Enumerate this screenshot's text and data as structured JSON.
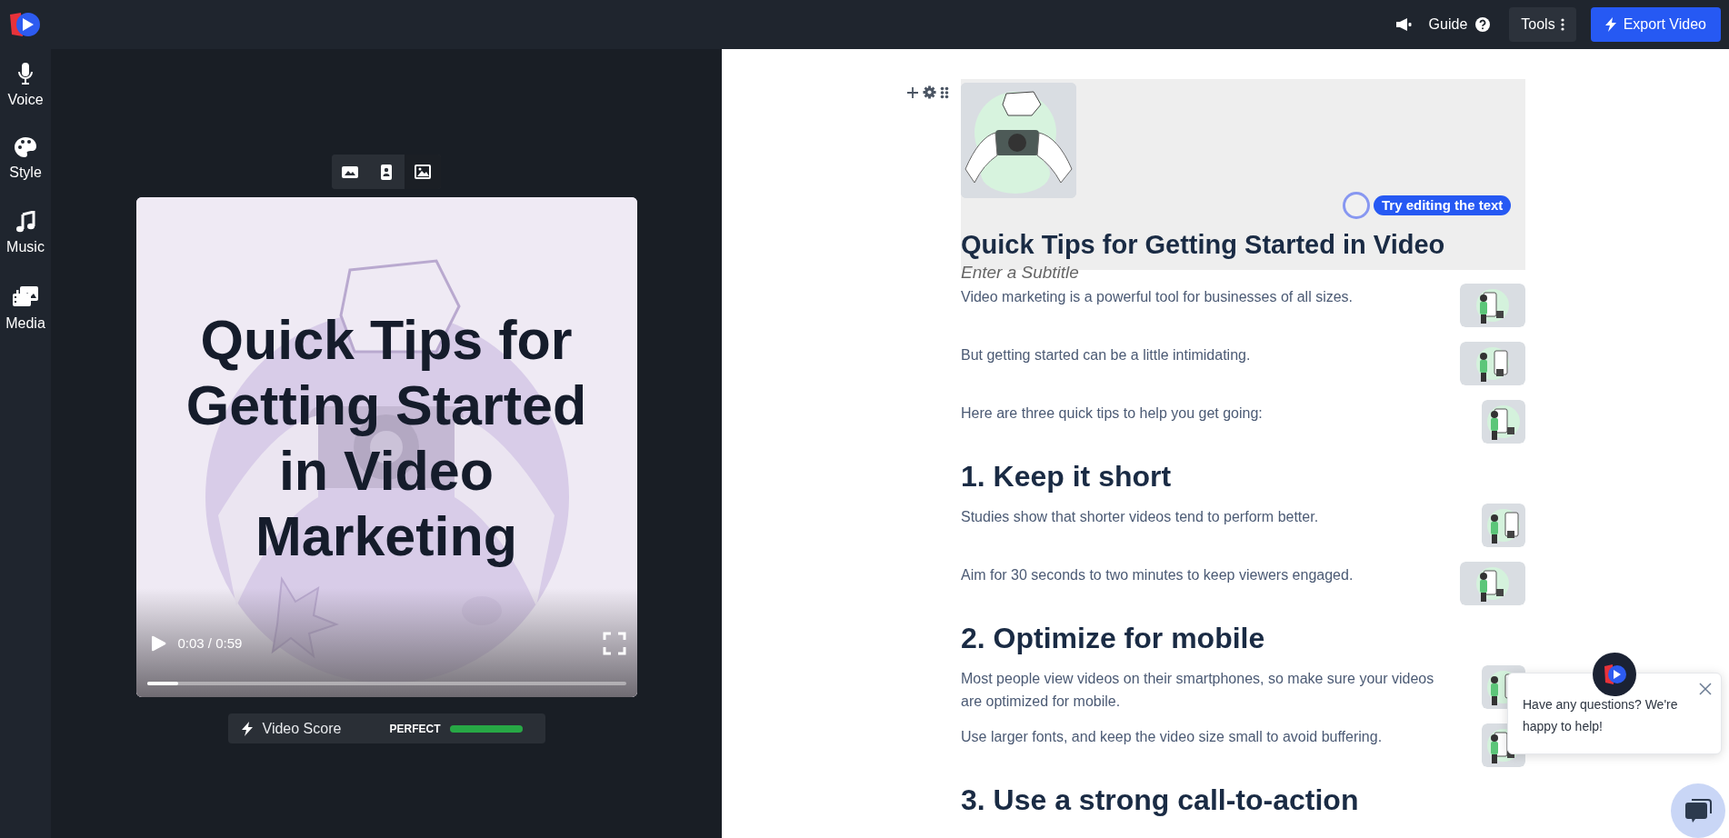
{
  "top_bar": {
    "guide_label": "Guide",
    "tools_label": "Tools",
    "export_label": "Export Video"
  },
  "sidebar": {
    "items": [
      {
        "label": "Voice"
      },
      {
        "label": "Style"
      },
      {
        "label": "Music"
      },
      {
        "label": "Media"
      }
    ]
  },
  "video_preview": {
    "layout_buttons": [
      {
        "selected": false
      },
      {
        "selected": false
      },
      {
        "selected": true
      }
    ],
    "title_overlay": "Quick Tips for Getting Started in Video Marketing",
    "time": "0:03 / 0:59",
    "progress": {
      "level": 0.065
    }
  },
  "video_score": {
    "label": "Video Score",
    "rating": "PERFECT",
    "level": 1
  },
  "document": {
    "title": "Quick Tips for Getting Started in Video",
    "subtitle_placeholder": "Enter a Subtitle",
    "tooltip": "Try editing the text",
    "blocks": [
      {
        "kind": "paragraph",
        "text": "Video marketing is a powerful tool for businesses of all sizes."
      },
      {
        "kind": "paragraph",
        "text": "But getting started can be a little intimidating."
      },
      {
        "kind": "paragraph",
        "text": "Here are three quick tips to help you get going:"
      },
      {
        "kind": "heading",
        "text": "1. Keep it short"
      },
      {
        "kind": "paragraph",
        "text": "Studies show that shorter videos tend to perform better."
      },
      {
        "kind": "paragraph",
        "text": "Aim for 30 seconds to two minutes to keep viewers engaged."
      },
      {
        "kind": "heading",
        "text": "2. Optimize for mobile"
      },
      {
        "kind": "paragraph",
        "text": "Most people view videos on their smartphones, so make sure your videos are optimized for mobile."
      },
      {
        "kind": "paragraph",
        "text": "Use larger fonts, and keep the video size small to avoid buffering."
      },
      {
        "kind": "heading",
        "text": "3. Use a strong call-to-action"
      }
    ]
  },
  "chat": {
    "message": "Have any questions? We're happy to help!"
  }
}
